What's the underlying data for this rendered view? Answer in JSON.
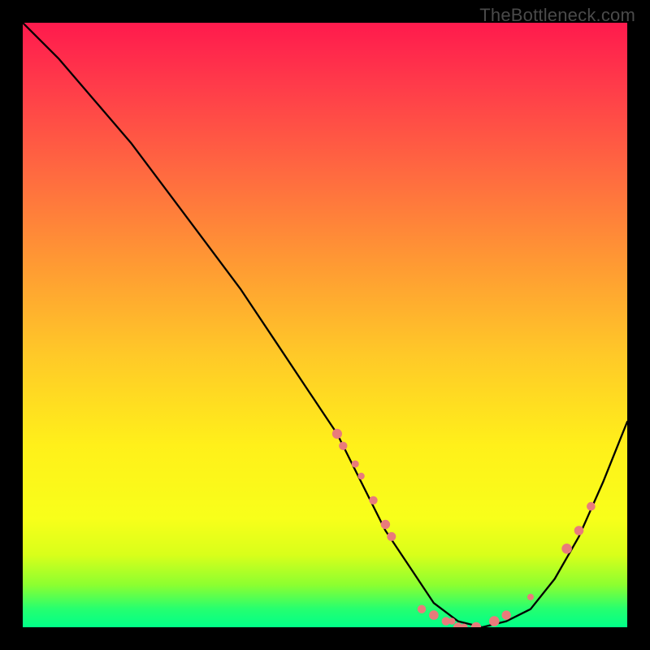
{
  "watermark": "TheBottleneck.com",
  "colors": {
    "background": "#000000",
    "curve": "#000000",
    "markers": "#e97b7b"
  },
  "chart_data": {
    "type": "line",
    "title": "",
    "xlabel": "",
    "ylabel": "",
    "xlim": [
      0,
      100
    ],
    "ylim": [
      0,
      100
    ],
    "x": [
      0,
      6,
      12,
      18,
      24,
      30,
      36,
      42,
      48,
      52,
      56,
      60,
      64,
      68,
      72,
      76,
      80,
      84,
      88,
      92,
      96,
      100
    ],
    "values": [
      100,
      94,
      87,
      80,
      72,
      64,
      56,
      47,
      38,
      32,
      24,
      16,
      10,
      4,
      1,
      0,
      1,
      3,
      8,
      15,
      24,
      34
    ],
    "markers": {
      "x": [
        52,
        53,
        55,
        56,
        58,
        60,
        61,
        66,
        68,
        70,
        71,
        72,
        73,
        75,
        78,
        80,
        84,
        90,
        92,
        94
      ],
      "values": [
        32,
        30,
        27,
        25,
        21,
        17,
        15,
        3,
        2,
        1,
        1,
        0,
        0,
        0,
        1,
        2,
        5,
        13,
        16,
        20
      ]
    }
  }
}
